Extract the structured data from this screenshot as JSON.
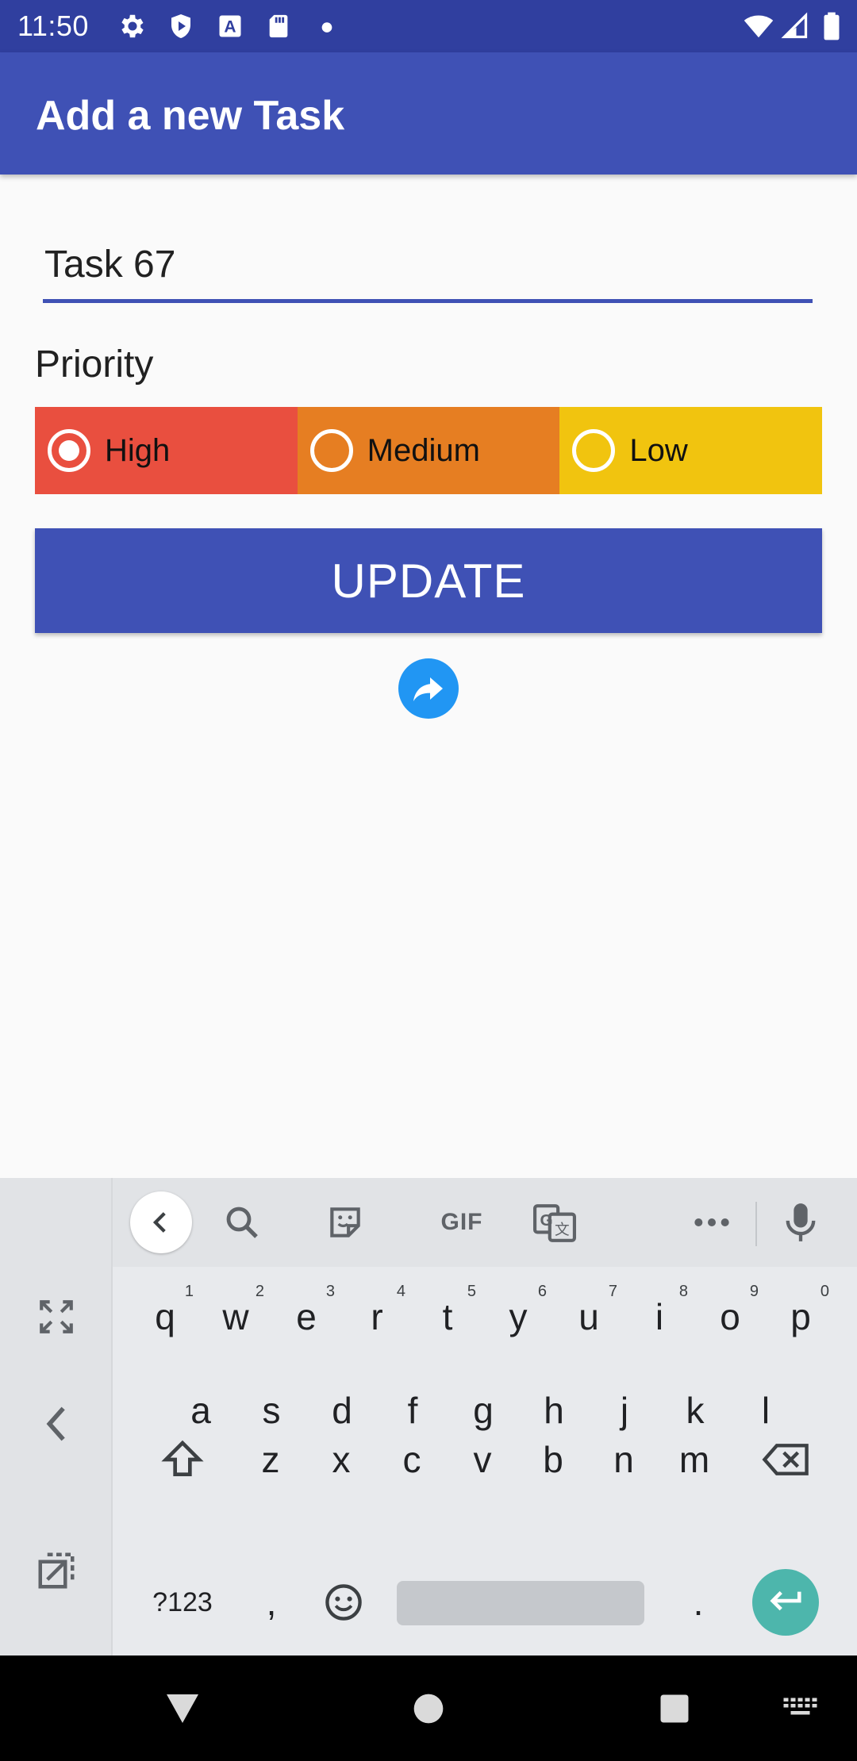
{
  "status_bar": {
    "time": "11:50"
  },
  "app_bar": {
    "title": "Add a new Task"
  },
  "form": {
    "task_value": "Task 67",
    "priority_label": "Priority",
    "priorities": [
      {
        "label": "High",
        "color": "#e94f3f",
        "checked": true
      },
      {
        "label": "Medium",
        "color": "#e67e22",
        "checked": false
      },
      {
        "label": "Low",
        "color": "#f1c40f",
        "checked": false
      }
    ],
    "update_label": "UPDATE"
  },
  "keyboard": {
    "row1": [
      {
        "key": "q",
        "hint": "1"
      },
      {
        "key": "w",
        "hint": "2"
      },
      {
        "key": "e",
        "hint": "3"
      },
      {
        "key": "r",
        "hint": "4"
      },
      {
        "key": "t",
        "hint": "5"
      },
      {
        "key": "y",
        "hint": "6"
      },
      {
        "key": "u",
        "hint": "7"
      },
      {
        "key": "i",
        "hint": "8"
      },
      {
        "key": "o",
        "hint": "9"
      },
      {
        "key": "p",
        "hint": "0"
      }
    ],
    "row2": [
      "a",
      "s",
      "d",
      "f",
      "g",
      "h",
      "j",
      "k",
      "l"
    ],
    "row3": [
      "z",
      "x",
      "c",
      "v",
      "b",
      "n",
      "m"
    ],
    "symbols_label": "?123",
    "comma": ",",
    "period": ".",
    "gif_label": "GIF"
  },
  "colors": {
    "primary": "#3f51b5",
    "primary_dark": "#303f9f",
    "share_blue": "#2196f3",
    "enter_teal": "#4db6ac"
  }
}
